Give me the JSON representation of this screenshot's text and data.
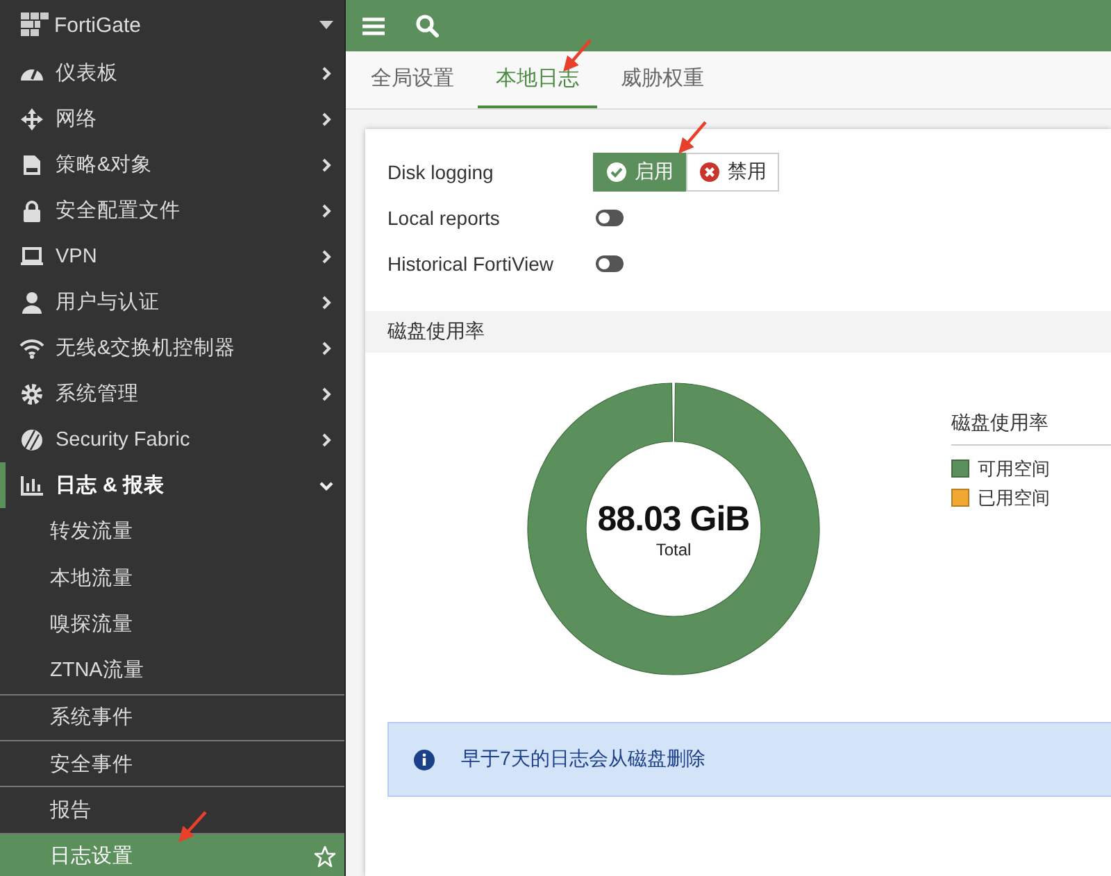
{
  "sidebar": {
    "brand": "FortiGate",
    "items": [
      {
        "label": "仪表板",
        "expanded": false
      },
      {
        "label": "网络",
        "expanded": false
      },
      {
        "label": "策略&对象",
        "expanded": false
      },
      {
        "label": "安全配置文件",
        "expanded": false
      },
      {
        "label": "VPN",
        "expanded": false
      },
      {
        "label": "用户与认证",
        "expanded": false
      },
      {
        "label": "无线&交换机控制器",
        "expanded": false
      },
      {
        "label": "系统管理",
        "expanded": false
      },
      {
        "label": "Security Fabric",
        "expanded": false
      },
      {
        "label": "日志 & 报表",
        "expanded": true,
        "children": [
          {
            "label": "转发流量",
            "selected": false,
            "divider_above": false
          },
          {
            "label": "本地流量",
            "selected": false,
            "divider_above": false
          },
          {
            "label": "嗅探流量",
            "selected": false,
            "divider_above": false
          },
          {
            "label": "ZTNA流量",
            "selected": false,
            "divider_above": false
          },
          {
            "label": "系统事件",
            "selected": false,
            "divider_above": true
          },
          {
            "label": "安全事件",
            "selected": false,
            "divider_above": true
          },
          {
            "label": "报告",
            "selected": false,
            "divider_above": true
          },
          {
            "label": "日志设置",
            "selected": true,
            "divider_above": true
          }
        ]
      }
    ]
  },
  "tabs": [
    {
      "label": "全局设置",
      "selected": false
    },
    {
      "label": "本地日志",
      "selected": true
    },
    {
      "label": "威胁权重",
      "selected": false
    }
  ],
  "settings": [
    {
      "kind": "segmented",
      "label": "Disk logging",
      "options": [
        {
          "label": "启用",
          "selected": true
        },
        {
          "label": "禁用",
          "selected": false
        }
      ]
    },
    {
      "kind": "toggle",
      "label": "Local reports",
      "on": false
    },
    {
      "kind": "toggle",
      "label": "Historical FortiView",
      "on": false
    }
  ],
  "disk_usage": {
    "title": "磁盘使用率",
    "total": "88.03 GiB",
    "total_label": "Total",
    "legend_title": "磁盘使用率",
    "legend": [
      {
        "label": "可用空间",
        "color": "#5b8f5b"
      },
      {
        "label": "已用空间",
        "color": "#f0a830"
      }
    ]
  },
  "notice": "早于7天的日志会从磁盘删除"
}
